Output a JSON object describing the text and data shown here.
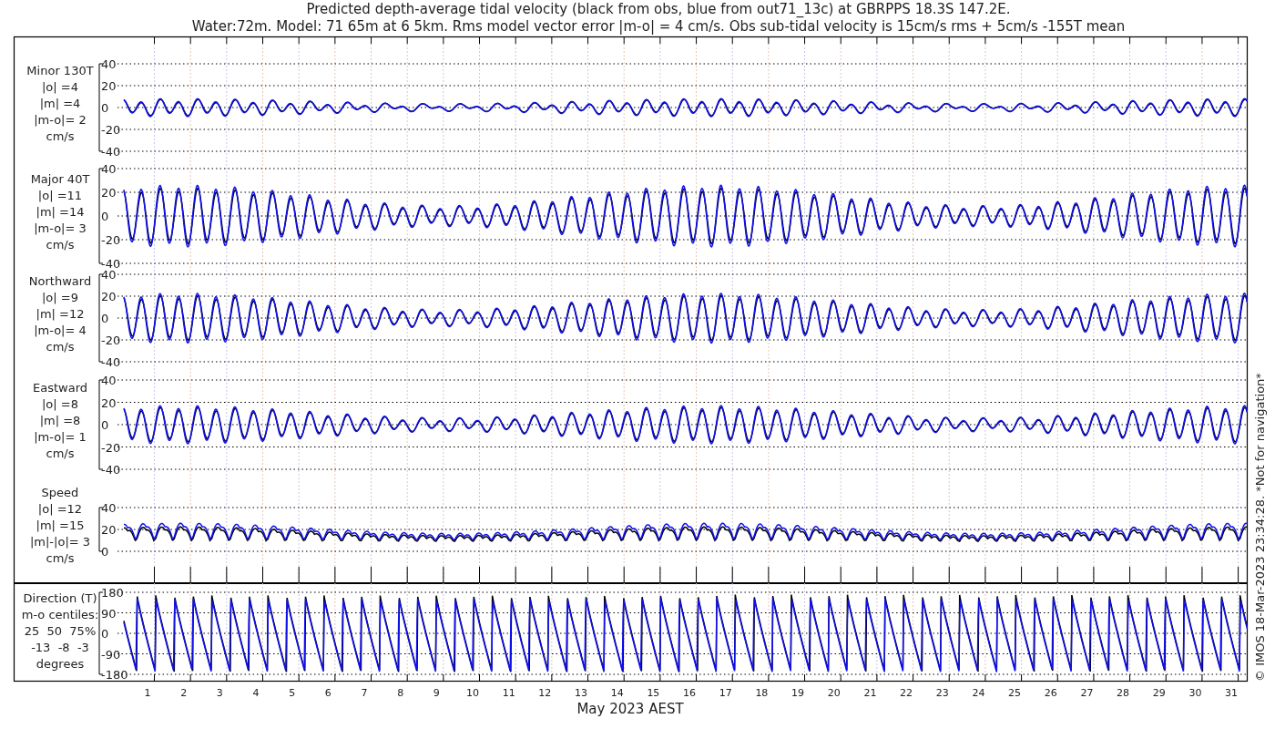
{
  "title_lines": [
    "Predicted depth-average tidal velocity (black from obs, blue from out71_13c) at GBRPPS 18.3S 147.2E.",
    "Water:72m. Model: 71 65m at 6 5km. Rms model vector error |m-o| = 4 cm/s. Obs sub-tidal velocity is 15cm/s rms + 5cm/s -155T mean"
  ],
  "panels": [
    {
      "kind": "velocity",
      "label_lines": [
        "Minor 130T",
        "|o| =4",
        "|m| =4",
        "|m-o|= 2",
        "cm/s"
      ],
      "yticks": [
        "40",
        "20",
        "0",
        "-20",
        "-40"
      ]
    },
    {
      "kind": "velocity",
      "label_lines": [
        "Major 40T",
        "|o| =11",
        "|m| =14",
        "|m-o|= 3",
        "cm/s"
      ],
      "yticks": [
        "40",
        "20",
        "0",
        "-20",
        "-40"
      ]
    },
    {
      "kind": "velocity",
      "label_lines": [
        "Northward",
        "|o| =9",
        "|m| =12",
        "|m-o|= 4",
        "cm/s"
      ],
      "yticks": [
        "40",
        "20",
        "0",
        "-20",
        "-40"
      ]
    },
    {
      "kind": "velocity",
      "label_lines": [
        "Eastward",
        "|o| =8",
        "|m| =8",
        "|m-o|= 1",
        "cm/s"
      ],
      "yticks": [
        "40",
        "20",
        "0",
        "-20",
        "-40"
      ]
    },
    {
      "kind": "speed",
      "label_lines": [
        "Speed",
        "|o| =12",
        "|m| =15",
        "|m|-|o|= 3",
        "cm/s"
      ],
      "yticks": [
        "40",
        "20",
        "0"
      ]
    },
    {
      "kind": "direction",
      "label_lines": [
        "Direction (T)",
        "m-o centiles:",
        "25  50  75%",
        "-13  -8  -3",
        "degrees"
      ],
      "yticks": [
        "180",
        "90",
        "0",
        "-90",
        "-180"
      ]
    }
  ],
  "x_ticks": [
    "1",
    "2",
    "3",
    "4",
    "5",
    "6",
    "7",
    "8",
    "9",
    "10",
    "11",
    "12",
    "13",
    "14",
    "15",
    "16",
    "17",
    "18",
    "19",
    "20",
    "21",
    "22",
    "23",
    "24",
    "25",
    "26",
    "27",
    "28",
    "29",
    "30",
    "31"
  ],
  "x_label": "May 2023 AEST",
  "side_note": "© IMOS 18-Mar-2023 23:34:28. *Not for navigation*"
}
